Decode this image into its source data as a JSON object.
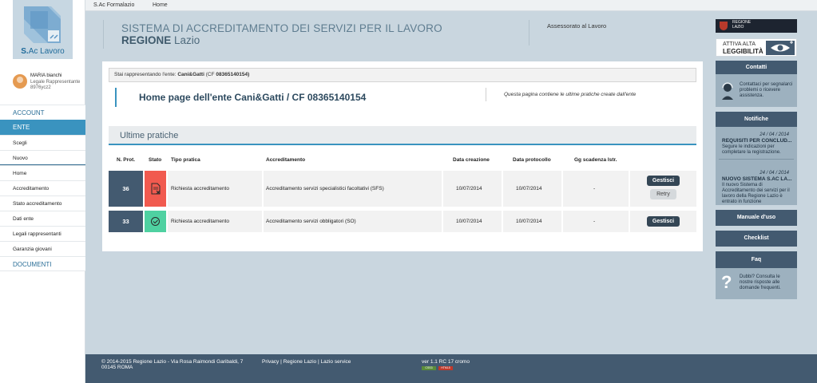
{
  "topbar": {
    "app_name": "S.Ac Formalazio",
    "home": "Home"
  },
  "sidebar": {
    "logo_prefix": "S.",
    "logo_text": "Ac Lavoro",
    "user": {
      "name": "MARIA bianchi",
      "role": "Legale Rappresentante",
      "code": "8976ycz2"
    },
    "nav": {
      "account": "ACCOUNT",
      "ente": "ENTE",
      "scegli": "Scegli",
      "nuovo": "Nuovo",
      "home": "Home",
      "accreditamento": "Accreditamento",
      "stato": "Stato accreditamento",
      "dati": "Dati ente",
      "legali": "Legali rappresentanti",
      "garanzia": "Garanzia giovani",
      "documenti": "DOCUMENTI"
    }
  },
  "header": {
    "line1": "SISTEMA DI ACCREDITAMENTO DEI SERVIZI PER IL LAVORO",
    "line2_bold": "REGIONE",
    "line2_rest": "Lazio",
    "assessorato": "Assessorato al Lavoro"
  },
  "main": {
    "rep_prefix": "Stai rappresentando l'ente:",
    "rep_name": "Cani&Gatti",
    "rep_cf_prefix": "(CF",
    "rep_cf": "08365140154)",
    "title": "Home page dell'ente Cani&Gatti / CF 08365140154",
    "note": "Questa pagina contiene le ultime pratiche create dall'ente",
    "section": "Ultime pratiche",
    "columns": {
      "prot": "N. Prot.",
      "stato": "Stato",
      "tipo": "Tipo pratica",
      "accr": "Accreditamento",
      "creazione": "Data creazione",
      "protocollo": "Data protocollo",
      "scadenza": "Gg scadenza Istr."
    },
    "rows": [
      {
        "prot": "36",
        "status": "error",
        "tipo": "Richiesta accreditamento",
        "accr": "Accreditamento servizi specialistici facoltativi (SFS)",
        "creazione": "10/07/2014",
        "protocollo": "10/07/2014",
        "scadenza": "-",
        "gestisci": "Gestisci",
        "retry": "Retry"
      },
      {
        "prot": "33",
        "status": "ok",
        "tipo": "Richiesta accreditamento",
        "accr": "Accreditamento servizi obbligatori (SO)",
        "creazione": "10/07/2014",
        "protocollo": "10/07/2014",
        "scadenza": "-",
        "gestisci": "Gestisci"
      }
    ],
    "status_colors": {
      "error": "#f15a4f",
      "ok": "#4fd1a1"
    }
  },
  "right": {
    "regione_logo_line1": "REGIONE",
    "regione_logo_line2": "LAZIO",
    "alta_line1": "ATTIVA ALTA",
    "alta_line2": "LEGGIBILITÀ",
    "contatti": "Contatti",
    "contatti_text": "Contattaci per segnalarci problemi o ricevere assistenza.",
    "notifiche": "Notifiche",
    "notif1_date": "24 / 04 / 2014",
    "notif1_title": "REQUISITI PER CONCLUD...",
    "notif1_body": "Segure le indicazioni per completare la registrazione.",
    "notif2_date": "24 / 04 / 2014",
    "notif2_title": "NUOVO SISTEMA S.AC LA...",
    "notif2_body": "Il nuovo Sistema di Accreditamento dei servizi per il lavoro della Regione Lazio è entrato in funzione",
    "manuale": "Manuale d'uso",
    "checklist": "Checklist",
    "faq": "Faq",
    "faq_text": "Dubbi? Consulta le nostre risposte alle domande frequenti."
  },
  "footer": {
    "copyright1": "© 2014-2015 Regione Lazio - Via Rosa Raimondi Garibaldi, 7",
    "copyright2": "00145 ROMA",
    "links": "Privacy | Regione Lazio | Lazio service",
    "version": "ver 1.1 RC 17 cromo",
    "badge1": "CSS3",
    "badge2": "HTML5"
  }
}
